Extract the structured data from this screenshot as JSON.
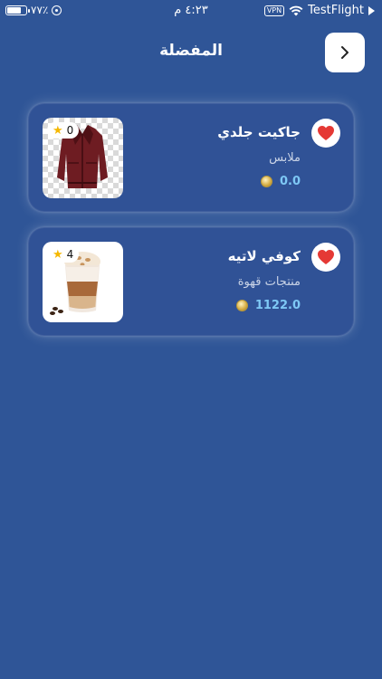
{
  "status_bar": {
    "battery_percent": "٧٧٪",
    "battery_level": 0.77,
    "time": "٤:٢٣ م",
    "vpn": "VPN",
    "carrier": "TestFlight"
  },
  "header": {
    "title": "المفضلة",
    "back_icon": "chevron-right-icon"
  },
  "favorites": [
    {
      "name": "جاكيت جلدي",
      "category": "ملابس",
      "price": "0.0",
      "rating": "0",
      "image": "leather-jacket",
      "favorite_icon": "heart-icon"
    },
    {
      "name": "كوفي لاتيه",
      "category": "منتجات قهوة",
      "price": "1122.0",
      "rating": "4",
      "image": "latte-glass",
      "favorite_icon": "heart-icon"
    }
  ],
  "colors": {
    "background": "#2f5597",
    "heart": "#e53935",
    "price": "#7ec8f5",
    "star": "#f5b800"
  }
}
